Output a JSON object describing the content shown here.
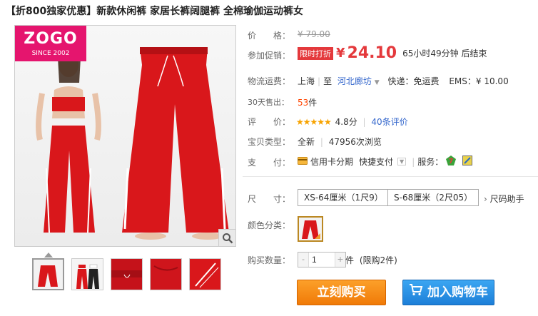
{
  "title": "【折800独家优惠】新款休闲裤 家居长裤阔腿裤 全棉瑜伽运动裤女",
  "logo": {
    "brand": "ZOGO",
    "since": "SINCE 2002"
  },
  "price": {
    "label": "价　　格：",
    "original": "¥ 79.00"
  },
  "promo": {
    "label": "参加促销：",
    "tag": "限时打折",
    "currency": "¥",
    "price": "24.10",
    "countdown": "65小时49分钟 后结束"
  },
  "shipping": {
    "label": "物流运费：",
    "from": "上海",
    "to_prefix": "至",
    "to": "河北廊坊",
    "express": "快递：免运费",
    "ems": "EMS：¥ 10.00"
  },
  "sales": {
    "label": "30天售出：",
    "count": "53",
    "unit": "件"
  },
  "rating": {
    "label": "评　　价：",
    "stars": "★★★★★",
    "score": "4.8分",
    "reviews": "40条评价"
  },
  "item_type": {
    "label": "宝贝类型：",
    "value": "全新",
    "views": "47956次浏览"
  },
  "payment": {
    "label": "支　　付：",
    "credit": "信用卡分期",
    "quick": "快捷支付",
    "service_label": "服务："
  },
  "size": {
    "label": "尺　　寸：",
    "options": [
      "XS-64厘米（1尺9）",
      "S-68厘米（2尺05）"
    ],
    "help": "尺码助手"
  },
  "color": {
    "label": "颜色分类："
  },
  "quantity": {
    "label": "购买数量：",
    "value": "1",
    "minus": "-",
    "plus": "+",
    "unit": "件",
    "limit": "(限购2件)"
  },
  "actions": {
    "buy_now": "立刻购买",
    "add_cart": "加入购物车"
  },
  "colors": {
    "accent": "#e4393c",
    "buy": "#f07a08",
    "cart": "#1d7fd8",
    "pants": "#d9171b"
  }
}
